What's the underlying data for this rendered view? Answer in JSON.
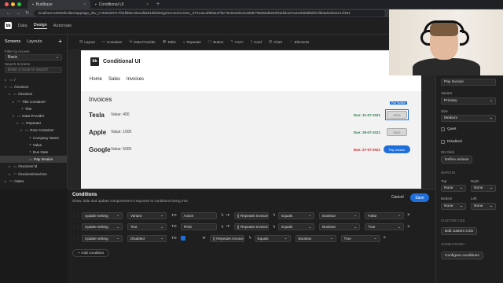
{
  "browser": {
    "tabs": [
      {
        "label": "Budibase",
        "active": true
      },
      {
        "label": "Conditional UI",
        "active": false
      }
    ],
    "url": "localhost:10000/builder/app/app_dev_c7330328717f41f9b8cc9ecafd291d8/design/screen/screen_37314ac4f9b8437fac76c63430c0cd39b/76b99ad8253f43d2b167a42eb58db0fe/clbb6dedSe4e1cf491"
  },
  "app": {
    "nav": [
      "Data",
      "Design",
      "Automate"
    ]
  },
  "left": {
    "tabs": [
      "Screens",
      "Layouts"
    ],
    "filter_label": "Filter by Access",
    "filter_value": "Basic",
    "search_label": "Search Screens",
    "search_placeholder": "Enter a route to search",
    "tree": [
      {
        "label": "/",
        "indent": 0,
        "caret": "▸",
        "icon": "▭"
      },
      {
        "label": "/invoices",
        "indent": 0,
        "caret": "▾",
        "icon": "▭"
      },
      {
        "label": "/invoices",
        "indent": 1,
        "caret": "▾",
        "icon": "▭"
      },
      {
        "label": "Title Container",
        "indent": 2,
        "caret": "▸",
        "icon": "▭"
      },
      {
        "label": "Title",
        "indent": 3,
        "caret": "",
        "icon": "T"
      },
      {
        "label": "Data Provider",
        "indent": 2,
        "caret": "▾",
        "icon": "▭"
      },
      {
        "label": "Repeater",
        "indent": 3,
        "caret": "▾",
        "icon": "▭"
      },
      {
        "label": "Row Container",
        "indent": 4,
        "caret": "▾",
        "icon": "▭"
      },
      {
        "label": "Company Name",
        "indent": 5,
        "caret": "",
        "icon": "T"
      },
      {
        "label": "Value",
        "indent": 5,
        "caret": "",
        "icon": "T"
      },
      {
        "label": "Due Date",
        "indent": 5,
        "caret": "",
        "icon": "T"
      },
      {
        "label": "Pay Invoice",
        "indent": 5,
        "caret": "",
        "icon": "▭",
        "selected": true
      },
      {
        "label": "/invoices/:id",
        "indent": 1,
        "caret": "▸",
        "icon": "▭"
      },
      {
        "label": "/invoices/new/row",
        "indent": 1,
        "caret": "▸",
        "icon": "▭"
      },
      {
        "label": "/sales",
        "indent": 0,
        "caret": "▸",
        "icon": "▭"
      }
    ]
  },
  "toolbar": {
    "items": [
      "Layout",
      "Container",
      "Data Provider",
      "Table",
      "Repeater",
      "Button",
      "Form",
      "Card",
      "Chart",
      "Elements"
    ]
  },
  "preview": {
    "app_title": "Conditional UI",
    "logo": "bb",
    "nav": [
      "Home",
      "Sales",
      "Invoices"
    ],
    "heading": "Invoices",
    "rows": [
      {
        "name": "Tesla",
        "value": "Value: 400",
        "due": "Due: 31-07-2021",
        "due_color": "#2e7d4f",
        "button": "PAID",
        "paid": true
      },
      {
        "name": "Apple",
        "value": "Value: 1000",
        "due": "Due: 28-07-2021",
        "due_color": "#2e7d4f",
        "button": "PAID",
        "paid": true
      },
      {
        "name": "Google",
        "value": "Value: 5000",
        "due": "Due: 27-07-2021",
        "due_color": "#c62828",
        "button": "Pay Invoice",
        "paid": false
      }
    ],
    "selected_tag": "Pay Invoice"
  },
  "conditions": {
    "title": "Conditions",
    "subtitle": "Show, hide and update components in response to conditions being met.",
    "cancel": "Cancel",
    "save": "Save",
    "rows": [
      {
        "action": "Update setting",
        "setting": "Variant",
        "to": "TO",
        "value": "Action",
        "if": "IF",
        "binding": "{{ Repeater.Invoices.I",
        "op": "Equals",
        "type": "Boolean",
        "ref": "False"
      },
      {
        "action": "Update setting",
        "setting": "Text",
        "to": "TO",
        "value": "PAID",
        "if": "IF",
        "binding": "{{ Repeater.Invoices.I",
        "op": "Equals",
        "type": "Boolean",
        "ref": "True"
      },
      {
        "action": "Update setting",
        "setting": "Disabled",
        "to": "TO",
        "value": "",
        "if": "IF",
        "binding": "{{ Repeater.Invoices.I",
        "op": "Equals",
        "type": "Boolean",
        "ref": "True"
      }
    ],
    "add": "Add condition"
  },
  "right": {
    "name_value": "Pay Invoice",
    "variant_label": "Variant",
    "variant_value": "Primary",
    "size_label": "Size",
    "size_value": "Medium",
    "quiet": "Quiet",
    "disabled": "Disabled",
    "onclick_label": "On Click",
    "define_actions": "Define actions",
    "margin_label": "MARGIN",
    "top_label": "Top",
    "right_label": "Right",
    "bottom_label": "Bottom",
    "leftm_label": "Left",
    "none": "None",
    "customcss_label": "CUSTOM CSS",
    "edit_css": "Edit custom CSS",
    "conditions_label": "CONDITIONS *",
    "configure": "Configure conditions"
  },
  "colors": {
    "accent": "#1e6fd9",
    "green": "#2e7d4f",
    "red": "#c62828"
  }
}
